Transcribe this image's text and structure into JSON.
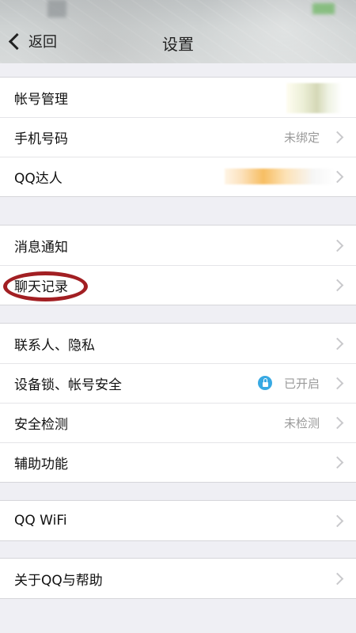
{
  "header": {
    "back_label": "返回",
    "title": "设置"
  },
  "groups": [
    {
      "items": [
        {
          "label": "帐号管理"
        },
        {
          "label": "手机号码",
          "value": "未绑定"
        },
        {
          "label": "QQ达人"
        }
      ]
    },
    {
      "items": [
        {
          "label": "消息通知"
        },
        {
          "label": "聊天记录"
        }
      ]
    },
    {
      "items": [
        {
          "label": "联系人、隐私"
        },
        {
          "label": "设备锁、帐号安全",
          "value": "已开启",
          "icon": "lock-icon"
        },
        {
          "label": "安全检测",
          "value": "未检测"
        },
        {
          "label": "辅助功能"
        }
      ]
    },
    {
      "items": [
        {
          "label": "QQ WiFi"
        }
      ]
    },
    {
      "items": [
        {
          "label": "关于QQ与帮助"
        }
      ]
    }
  ],
  "colors": {
    "accent": "#38a9e3",
    "highlight": "#a21f23"
  }
}
